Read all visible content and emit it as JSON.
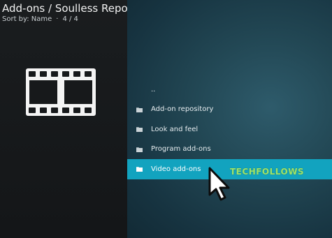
{
  "header": {
    "title": "Add-ons / Soulless Repo",
    "sort_label": "Sort by: Name",
    "separator": "·",
    "count": "4 / 4"
  },
  "left_icon": "film-strip-icon",
  "list": {
    "items": [
      {
        "label": "..",
        "icon": "parent-folder",
        "selected": false
      },
      {
        "label": "Add-on repository",
        "icon": "folder-icon",
        "selected": false
      },
      {
        "label": "Look and feel",
        "icon": "folder-icon",
        "selected": false
      },
      {
        "label": "Program add-ons",
        "icon": "folder-icon",
        "selected": false
      },
      {
        "label": "Video add-ons",
        "icon": "folder-icon",
        "selected": true
      }
    ]
  },
  "watermark": "TECHFOLLOWS",
  "colors": {
    "selection": "#12a3bf",
    "background_left": "#141618",
    "background_right": "#224754",
    "watermark": "#9fe36b"
  }
}
